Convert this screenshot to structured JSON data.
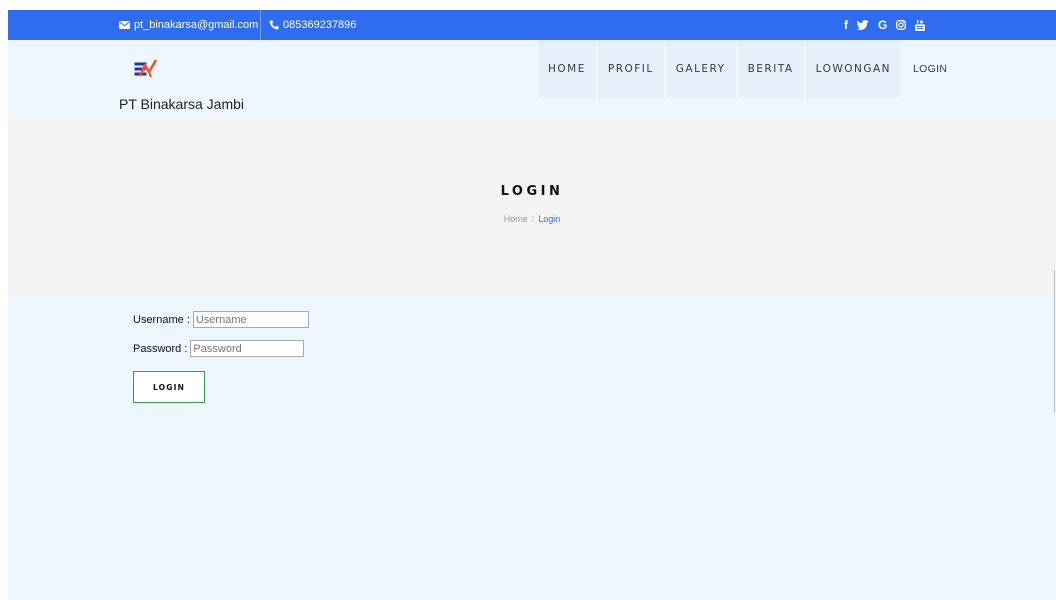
{
  "topbar": {
    "email": "pt_binakarsa@gmail.com",
    "phone": "085369237896",
    "social_icons": [
      "facebook-icon",
      "twitter-icon",
      "google-icon",
      "instagram-icon",
      "youtube-icon"
    ],
    "social_labels": {
      "facebook": "f",
      "google": "G"
    }
  },
  "brand": {
    "name": "PT Binakarsa Jambi"
  },
  "nav": {
    "items": [
      {
        "label": "HOME"
      },
      {
        "label": "PROFIL"
      },
      {
        "label": "GALERY"
      },
      {
        "label": "BERITA"
      },
      {
        "label": "LOWONGAN"
      },
      {
        "label": "LOGIN"
      }
    ]
  },
  "hero": {
    "title": "LOGIN",
    "breadcrumb_home": "Home",
    "breadcrumb_divider": "/",
    "breadcrumb_current": "Login"
  },
  "form": {
    "username_label": "Username :",
    "username_placeholder": "Username",
    "password_label": "Password :",
    "password_placeholder": "Password",
    "submit_label": "LOGIN"
  },
  "colors": {
    "topbar": "#2f6dee",
    "page_bg": "#eef6ff",
    "hero_bg": "#f4f4f4",
    "accent": "#2f6dee",
    "button_border": "#2e9d45"
  }
}
